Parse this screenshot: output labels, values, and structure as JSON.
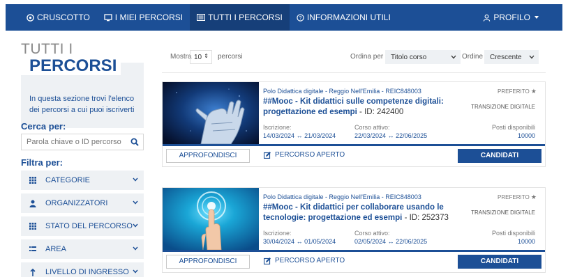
{
  "nav": {
    "items": [
      {
        "label": "CRUSCOTTO",
        "icon": "dashboard-icon"
      },
      {
        "label": "I MIEI PERCORSI",
        "icon": "monitor-icon"
      },
      {
        "label": "TUTTI I PERCORSI",
        "icon": "list-icon",
        "active": true
      },
      {
        "label": "INFORMAZIONI UTILI",
        "icon": "help-circle-icon"
      }
    ],
    "profile_label": "PROFILO"
  },
  "sidebar": {
    "title_line1": "TUTTI I",
    "title_line2": "PERCORSI",
    "intro_text": "In questa sezione trovi l'elenco dei percorsi a cui puoi iscriverti",
    "search_label": "Cerca per:",
    "search_placeholder": "Parola chiave o ID percorso",
    "filter_label": "Filtra per:",
    "filters": [
      {
        "label": "CATEGORIE",
        "icon": "grid-icon"
      },
      {
        "label": "ORGANIZZATORI",
        "icon": "user-icon"
      },
      {
        "label": "STATO DEL PERCORSO",
        "icon": "grid-icon"
      },
      {
        "label": "AREA",
        "icon": "list-icon"
      },
      {
        "label": "LIVELLO DI INGRESSO",
        "icon": "arrow-up-icon"
      }
    ]
  },
  "toolbar": {
    "show_label": "Mostra",
    "show_value": "10",
    "show_suffix": "percorsi",
    "sort_label": "Ordina per",
    "sort_value": "Titolo corso",
    "order_label": "Ordine",
    "order_value": "Crescente"
  },
  "cards": [
    {
      "organizer": "Polo Didattica digitale - Reggio Nell'Emilia - REIC848003",
      "title": "##Mooc - Kit didattici sulle competenze digitali: progettazione ed esempi",
      "id_text": " - ID: 242400",
      "favorite_label": "PREFERITO",
      "category": "TRANSIZIONE DIGITALE",
      "enrollment_label": "Iscrizione:",
      "enrollment_start": "14/03/2024",
      "enrollment_end": "21/03/2024",
      "active_label": "Corso attivo:",
      "active_start": "22/03/2024",
      "active_end": "22/06/2025",
      "seats_label": "Posti disponibili",
      "seats_value": "10000",
      "details_button": "APPROFONDISCI",
      "status_label": "PERCORSO APERTO",
      "apply_button": "CANDIDATI",
      "image": "robot-hand-image"
    },
    {
      "organizer": "Polo Didattica digitale - Reggio Nell'Emilia - REIC848003",
      "title": "##Mooc - Kit didattici per collaborare usando le tecnologie: progettazione ed esempi",
      "id_text": " - ID: 252373",
      "favorite_label": "PREFERITO",
      "category": "TRANSIZIONE DIGITALE",
      "enrollment_label": "Iscrizione:",
      "enrollment_start": "30/04/2024",
      "enrollment_end": "01/05/2024",
      "active_label": "Corso attivo:",
      "active_start": "02/05/2024",
      "active_end": "22/06/2025",
      "seats_label": "Posti disponibili",
      "seats_value": "10000",
      "details_button": "APPROFONDISCI",
      "status_label": "PERCORSO APERTO",
      "apply_button": "CANDIDATI",
      "image": "touch-finger-image"
    }
  ],
  "colors": {
    "primary": "#1c4f96",
    "active_nav": "#163f79",
    "panel": "#eef1f4"
  }
}
